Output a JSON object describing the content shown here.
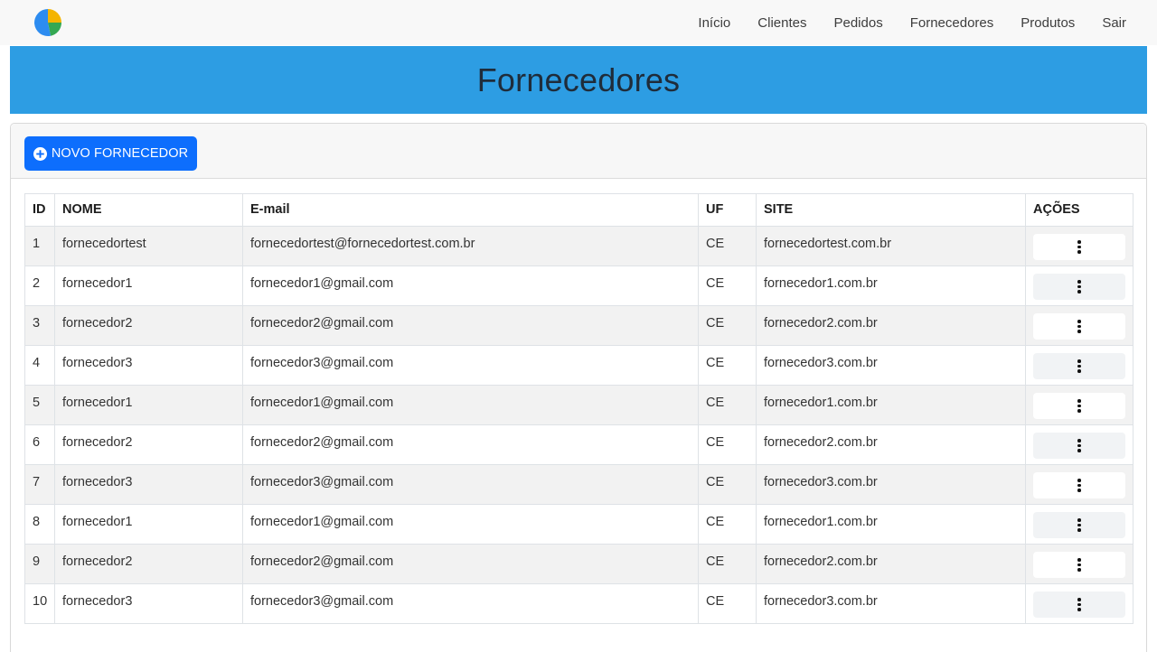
{
  "nav": {
    "logo_icon": "pie-chart-logo-icon",
    "links": [
      "Início",
      "Clientes",
      "Pedidos",
      "Fornecedores",
      "Produtos",
      "Sair"
    ]
  },
  "banner": {
    "title": "Fornecedores",
    "color": "#2d9de3"
  },
  "toolbar": {
    "new_label": "NOVO FORNECEDOR",
    "new_icon": "plus-circle-icon",
    "accent": "#0d6efd"
  },
  "table": {
    "headers": [
      "ID",
      "NOME",
      "E-mail",
      "UF",
      "SITE",
      "AÇÕES"
    ],
    "rows": [
      [
        "1",
        "fornecedortest",
        "fornecedortest@fornecedortest.com.br",
        "CE",
        "fornecedortest.com.br"
      ],
      [
        "2",
        "fornecedor1",
        "fornecedor1@gmail.com",
        "CE",
        "fornecedor1.com.br"
      ],
      [
        "3",
        "fornecedor2",
        "fornecedor2@gmail.com",
        "CE",
        "fornecedor2.com.br"
      ],
      [
        "4",
        "fornecedor3",
        "fornecedor3@gmail.com",
        "CE",
        "fornecedor3.com.br"
      ],
      [
        "5",
        "fornecedor1",
        "fornecedor1@gmail.com",
        "CE",
        "fornecedor1.com.br"
      ],
      [
        "6",
        "fornecedor2",
        "fornecedor2@gmail.com",
        "CE",
        "fornecedor2.com.br"
      ],
      [
        "7",
        "fornecedor3",
        "fornecedor3@gmail.com",
        "CE",
        "fornecedor3.com.br"
      ],
      [
        "8",
        "fornecedor1",
        "fornecedor1@gmail.com",
        "CE",
        "fornecedor1.com.br"
      ],
      [
        "9",
        "fornecedor2",
        "fornecedor2@gmail.com",
        "CE",
        "fornecedor2.com.br"
      ],
      [
        "10",
        "fornecedor3",
        "fornecedor3@gmail.com",
        "CE",
        "fornecedor3.com.br"
      ]
    ],
    "action_icon": "more-vertical-icon"
  }
}
